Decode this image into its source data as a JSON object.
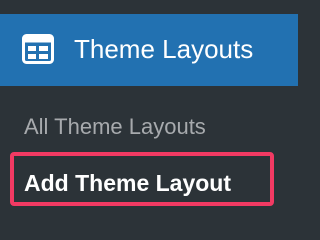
{
  "menu": {
    "icon": "layout-grid-icon",
    "title": "Theme Layouts",
    "items": [
      {
        "label": "All Theme Layouts",
        "current": false
      },
      {
        "label": "Add Theme Layout",
        "current": true
      }
    ]
  },
  "colors": {
    "sidebar_bg": "#2c3338",
    "active_header_bg": "#2271b1",
    "submenu_text": "#a7aaad",
    "current_text": "#ffffff",
    "highlight_border": "#f23a63"
  }
}
